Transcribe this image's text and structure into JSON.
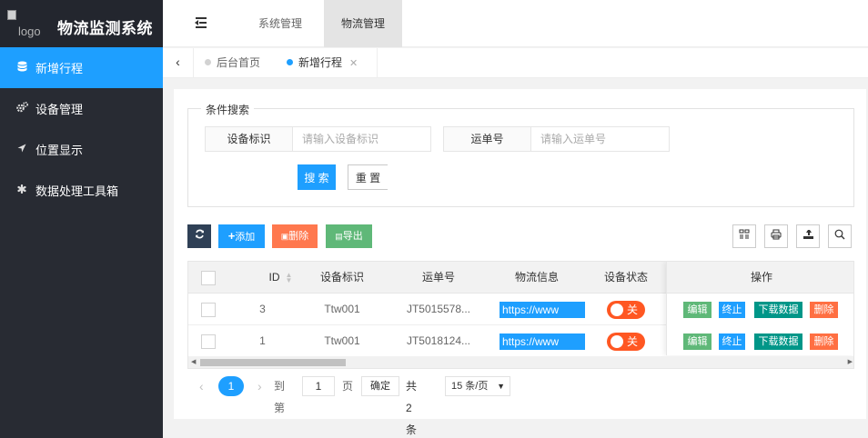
{
  "app": {
    "logo_text": "logo",
    "title": "物流监测系统"
  },
  "sidebar": {
    "items": [
      {
        "label": "新增行程",
        "icon": "database-icon",
        "active": true
      },
      {
        "label": "设备管理",
        "icon": "gears-icon",
        "active": false
      },
      {
        "label": "位置显示",
        "icon": "location-arrow-icon",
        "active": false
      },
      {
        "label": "数据处理工具箱",
        "icon": "asterisk-icon",
        "active": false
      }
    ]
  },
  "topnav": {
    "items": [
      {
        "label": "系统管理"
      },
      {
        "label": "物流管理"
      }
    ],
    "active_index": 1
  },
  "tabs": [
    {
      "label": "后台首页"
    },
    {
      "label": "新增行程"
    }
  ],
  "search": {
    "legend": "条件搜索",
    "device_label": "设备标识",
    "device_placeholder": "请输入设备标识",
    "waybill_label": "运单号",
    "waybill_placeholder": "请输入运单号",
    "search_button": "搜 索",
    "reset_button": "重 置"
  },
  "toolbar": {
    "add": "添加",
    "delete": "删除",
    "export": "导出"
  },
  "table": {
    "columns": [
      "ID",
      "设备标识",
      "运单号",
      "物流信息",
      "设备状态",
      "操作"
    ],
    "rows": [
      {
        "id": "3",
        "device": "Ttw001",
        "waybill": "JT5015578...",
        "info": "https://www",
        "status": "关"
      },
      {
        "id": "1",
        "device": "Ttw001",
        "waybill": "JT5018124...",
        "info": "https://www",
        "status": "关"
      }
    ],
    "actions": {
      "edit": "编辑",
      "stop": "终止",
      "download": "下载数据",
      "delete": "删除"
    }
  },
  "pagination": {
    "current": "1",
    "goto_label": "到第",
    "goto_value": "1",
    "page_unit": "页",
    "confirm": "确定",
    "total": "共 2 条",
    "page_size": "15 条/页"
  },
  "colors": {
    "primary": "#1e9fff",
    "sidebar": "#282b33",
    "danger": "#ff5722",
    "success": "#5fb878",
    "teal": "#009688"
  }
}
